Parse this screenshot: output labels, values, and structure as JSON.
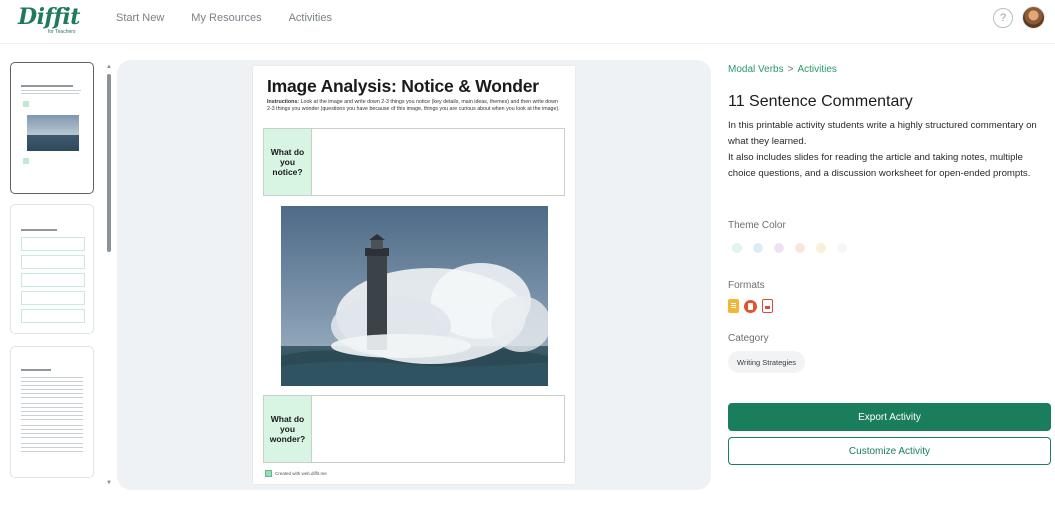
{
  "header": {
    "logo_text": "Diffit",
    "logo_subtext": "for Teachers",
    "nav_items": [
      "Start New",
      "My Resources",
      "Activities"
    ],
    "help_icon": "question-circle-icon",
    "help_glyph": "?",
    "avatar_icon": "user-avatar"
  },
  "preview": {
    "scroll_up_glyph": "▲",
    "scroll_down_glyph": "▼",
    "page": {
      "title": "Image Analysis: Notice & Wonder",
      "instructions_bold": "Instructions:",
      "instructions": "Look at the image and write down 2-3 things you notice (key details, main ideas, themes) and then write down 2-3 things you wonder (questions you have because of this image, things you are curious about when you look at the image).",
      "notice_label": "What do you notice?",
      "wonder_label": "What do you wonder?",
      "footer": "Created with web.diffit.me"
    }
  },
  "details": {
    "breadcrumb": [
      "Modal Verbs",
      "Activities"
    ],
    "breadcrumb_separator": ">",
    "title": "11 Sentence Commentary",
    "description": [
      "In this printable activity students write a highly structured commentary on what they learned.",
      "It also includes slides for reading the article and taking notes, multiple choice questions, and a discussion worksheet for open-ended prompts."
    ],
    "theme_label": "Theme Color",
    "theme_colors": [
      "#e2f4ec",
      "#dcecf7",
      "#efe2f6",
      "#fbe4dc",
      "#f6f1d8",
      "#f5f5f5"
    ],
    "formats_label": "Formats",
    "formats": [
      "google-docs-icon",
      "powerpoint-icon",
      "pdf-icon"
    ],
    "category_label": "Category",
    "category": "Writing Strategies",
    "export_label": "Export Activity",
    "customize_label": "Customize Activity",
    "accent_color": "#1a7d5b"
  }
}
